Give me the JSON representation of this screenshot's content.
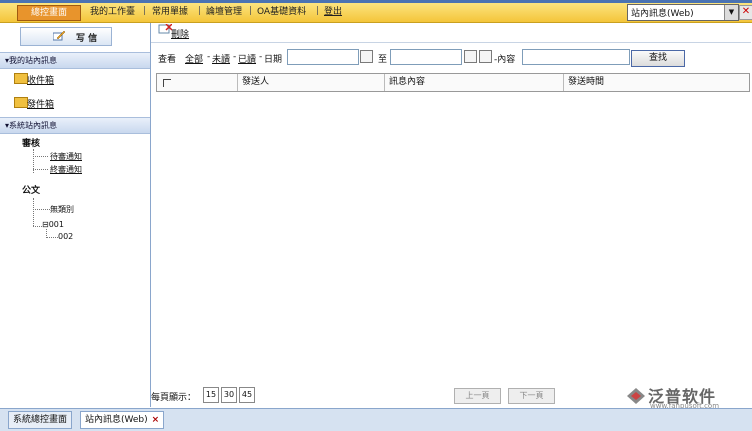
{
  "topbar": {
    "home": "總控畫面",
    "menus": [
      "我的工作臺",
      "常用單據",
      "論壇管理",
      "OA基礎資料",
      "登出"
    ],
    "system_select": "站內訊息(Web)"
  },
  "sidebar": {
    "compose": "写 信",
    "section_my": "我的站內訊息",
    "inbox": "收件箱",
    "outbox": "發件箱",
    "section_sys": "系統站內訊息",
    "review": "審核",
    "review_items": [
      "待審通知",
      "終審通知"
    ],
    "docs": "公文",
    "doc_tree": [
      "無類別",
      "001",
      "002"
    ]
  },
  "toolbar": {
    "delete": "刪除",
    "view_label": "查看",
    "filter_all": "全部",
    "filter_unread": "未讀",
    "filter_read": "已讀",
    "date_label": "日期",
    "to_label": "至",
    "content_label": "內容",
    "search": "查找"
  },
  "grid": {
    "columns": [
      "發送人",
      "訊息內容",
      "發送時間"
    ]
  },
  "pager": {
    "per_page_label": "每頁顯示：",
    "sizes": [
      "15",
      "30",
      "45"
    ],
    "prev": "上一頁",
    "next": "下一頁"
  },
  "logo": {
    "name": "泛普软件",
    "url": "www.fanpusoft.com"
  },
  "tabs": [
    "系統總控畫面",
    "站內訊息(Web)"
  ]
}
